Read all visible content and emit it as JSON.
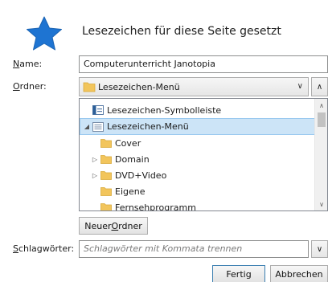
{
  "dialog": {
    "title": "Lesezeichen für diese Seite gesetzt"
  },
  "name_field": {
    "label_prefix": "",
    "label_underlined": "N",
    "label_rest": "ame:",
    "value": "Computerunterricht Janotopia"
  },
  "folder_field": {
    "label_prefix": "",
    "label_underlined": "O",
    "label_rest": "rdner:",
    "selected": "Lesezeichen-Menü"
  },
  "tree": {
    "items": [
      {
        "label": "Lesezeichen-Symbolleiste",
        "icon": "toolbar-icon",
        "expand": ""
      },
      {
        "label": "Lesezeichen-Menü",
        "icon": "menu-icon",
        "expand": "◢"
      },
      {
        "label": "Cover",
        "icon": "folder-icon",
        "expand": ""
      },
      {
        "label": "Domain",
        "icon": "folder-icon",
        "expand": "▷"
      },
      {
        "label": "DVD+Video",
        "icon": "folder-icon",
        "expand": "▷"
      },
      {
        "label": "Eigene",
        "icon": "folder-icon",
        "expand": ""
      },
      {
        "label": "Fernsehprogramm",
        "icon": "folder-icon",
        "expand": ""
      }
    ]
  },
  "new_folder_button": {
    "label_prefix": "Neuer ",
    "label_underlined": "O",
    "label_rest": "rdner"
  },
  "tags_field": {
    "label_prefix": "",
    "label_underlined": "S",
    "label_rest": "chlagwörter:",
    "placeholder": "Schlagwörter mit Kommata trennen"
  },
  "buttons": {
    "done": "Fertig",
    "cancel": "Abbrechen"
  },
  "colors": {
    "star": "#1e74d2",
    "folder": "#f2c55c",
    "selection": "#cce4f7"
  }
}
